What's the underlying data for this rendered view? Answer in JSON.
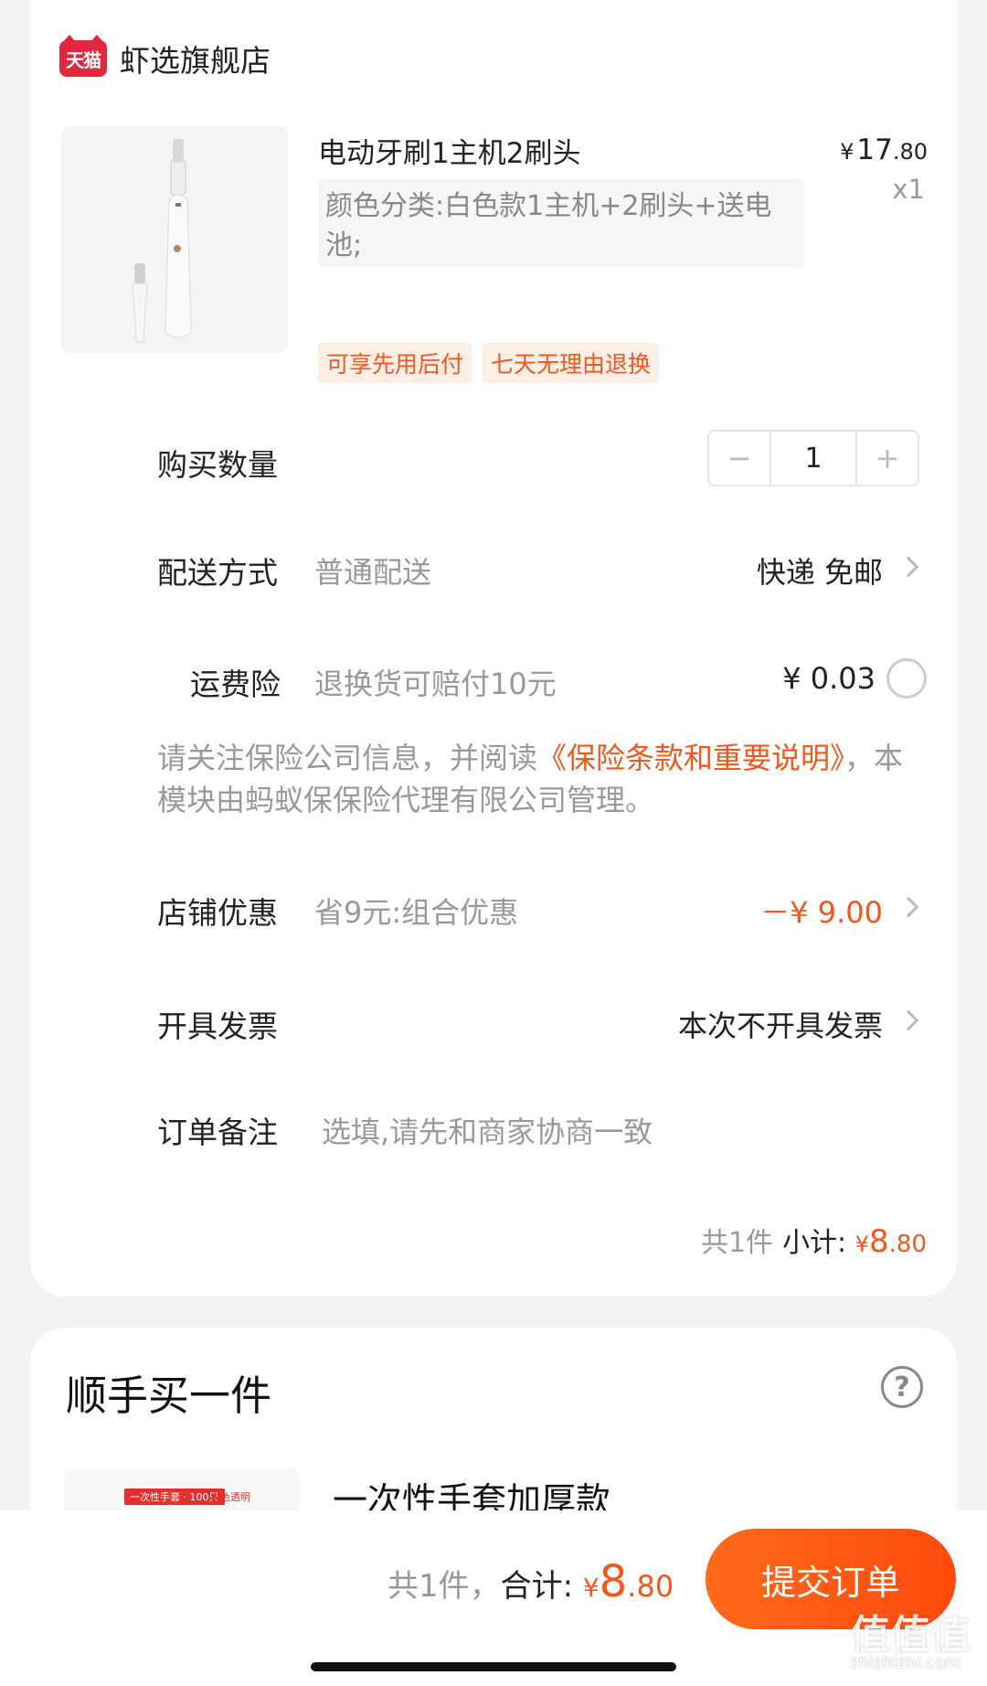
{
  "shop": {
    "name": "虾选旗舰店",
    "logo_text": "天猫"
  },
  "product": {
    "title": "电动牙刷1主机2刷头",
    "sku": "颜色分类:白色款1主机+2刷头+送电池;",
    "price_symbol": "¥",
    "price_int": "17",
    "price_dec": ".80",
    "quantity_label": "x1",
    "tags": [
      "可享先用后付",
      "七天无理由退换"
    ]
  },
  "order": {
    "quantity": {
      "label": "购买数量",
      "minus": "−",
      "value": "1",
      "plus": "+"
    },
    "delivery": {
      "label": "配送方式",
      "sub": "普通配送",
      "value": "快递 免邮"
    },
    "insurance": {
      "label": "运费险",
      "sub": "退换货可赔付10元",
      "value": "¥ 0.03"
    },
    "insurance_note": {
      "prefix": "请关注保险公司信息，并阅读",
      "link": "《保险条款和重要说明》",
      "suffix": "，本模块由蚂蚁保保险代理有限公司管理。"
    },
    "discount": {
      "label": "店铺优惠",
      "sub": "省9元:组合优惠",
      "value": "－¥ 9.00"
    },
    "invoice": {
      "label": "开具发票",
      "value": "本次不开具发票"
    },
    "remark": {
      "label": "订单备注",
      "placeholder": "选填,请先和商家协商一致"
    },
    "subtotal": {
      "count": "共1件",
      "label": "小计:",
      "symbol": "¥",
      "int": "8",
      "dec": ".80"
    }
  },
  "addon": {
    "title": "顺手买一件",
    "help_icon": "?",
    "item_title": "一次性手套加厚款",
    "item_tag": "一次性手套 · 100只",
    "item_tag2": "白色透明"
  },
  "footer": {
    "count": "共1件，",
    "total_label": "合计:",
    "symbol": "¥",
    "int": "8",
    "dec": ".80",
    "submit": "提交订单"
  },
  "watermark": {
    "text": "值值值",
    "sub": "zhizhizhi.com"
  },
  "colors": {
    "accent": "#f2571c",
    "tmall_red": "#e4253e"
  }
}
